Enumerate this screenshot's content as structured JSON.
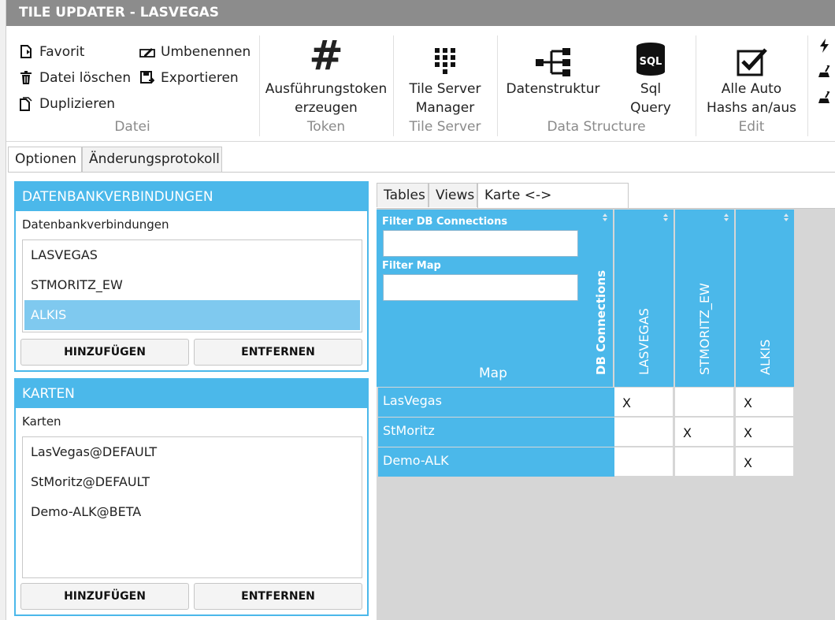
{
  "window": {
    "title": "TILE UPDATER - LASVEGAS"
  },
  "ribbon": {
    "datei": {
      "label": "Datei",
      "favorit": "Favorit",
      "loeschen": "Datei löschen",
      "duplizieren": "Duplizieren",
      "umbenennen": "Umbenennen",
      "exportieren": "Exportieren"
    },
    "token": {
      "label": "Token",
      "line1": "Ausführungstoken",
      "line2": "erzeugen"
    },
    "tileserver": {
      "label": "Tile Server",
      "line1": "Tile Server",
      "line2": "Manager"
    },
    "datastructure": {
      "label": "Data Structure",
      "datenstruktur": "Datenstruktur",
      "sql_line1": "Sql",
      "sql_line2": "Query",
      "sql_badge": "SQL"
    },
    "edit": {
      "label": "Edit",
      "line1": "Alle Auto",
      "line2": "Hashs an/aus"
    }
  },
  "tabs": [
    "Optionen",
    "Änderungsprotokoll"
  ],
  "db_panel": {
    "title": "DATENBANKVERBINDUNGEN",
    "subtitle": "Datenbankverbindungen",
    "items": [
      "LASVEGAS",
      "STMORITZ_EW",
      "ALKIS"
    ],
    "selected_index": 2,
    "add": "HINZUFÜGEN",
    "remove": "ENTFERNEN"
  },
  "maps_panel": {
    "title": "KARTEN",
    "subtitle": "Karten",
    "items": [
      "LasVegas@DEFAULT",
      "StMoritz@DEFAULT",
      "Demo-ALK@BETA"
    ],
    "add": "HINZUFÜGEN",
    "remove": "ENTFERNEN"
  },
  "subtabs": [
    "Tables",
    "Views",
    "Karte <-> Datenbank"
  ],
  "matrix": {
    "filter_db_label": "Filter DB Connections",
    "filter_db_value": "",
    "filter_map_label": "Filter Map",
    "filter_map_value": "",
    "db_connections_label": "DB Connections",
    "map_label": "Map",
    "columns": [
      "LASVEGAS",
      "STMORITZ_EW",
      "ALKIS"
    ],
    "rows": [
      {
        "name": "LasVegas",
        "cells": [
          "X",
          "",
          "X"
        ]
      },
      {
        "name": "StMoritz",
        "cells": [
          "",
          "X",
          "X"
        ]
      },
      {
        "name": "Demo-ALK",
        "cells": [
          "",
          "",
          "X"
        ]
      }
    ]
  },
  "colors": {
    "accent": "#4bb8ea",
    "selection": "#7fc9ef",
    "titlebar": "#8c8c8c"
  }
}
